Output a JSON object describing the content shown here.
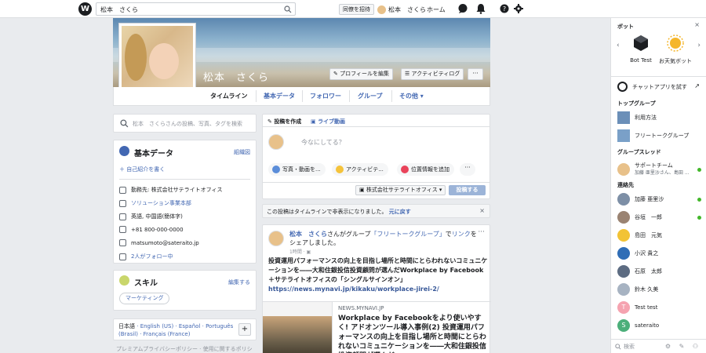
{
  "topbar": {
    "logo": "W",
    "search_value": "松本　さくら",
    "invite_label": "同僚を招待",
    "user_name": "松本　さくら",
    "home_label": "ホーム"
  },
  "profile": {
    "name": "松本　さくら",
    "edit_profile_label": "プロフィールを編集",
    "activity_log_label": "アクティビティログ",
    "more_label": "···",
    "tabs": [
      "タイムライン",
      "基本データ",
      "フォロワー",
      "グループ",
      "その他 ▾"
    ]
  },
  "left": {
    "search_placeholder": "松本　さくらさんの投稿、写真、タグを検索",
    "about": {
      "title": "基本データ",
      "edit_label": "組織図",
      "intro_label": "＋  自己紹介を書く",
      "rows": [
        "勤務先: 株式会社サテライトオフィス",
        "ソリューション事業本部",
        "英語, 中国語(簡体字)",
        "+81 800-000-0000",
        "matsumoto@sateraito.jp",
        "2人がフォロー中"
      ]
    },
    "skills": {
      "title": "スキル",
      "edit_label": "編集する",
      "chip": "マーケティング"
    },
    "languages": {
      "lang1": "日本語",
      "lang2": "English (US)",
      "lang3": "Español",
      "lang4": "Português (Brasil)",
      "lang5": "Français (France)",
      "add_label": "+"
    },
    "footer": "プレミアムプライバシーポリシー · 使用に関するポリシ"
  },
  "composer": {
    "tab_post": "投稿を作成",
    "tab_live": "ライブ動画",
    "placeholder": "今なにしてる？",
    "opt_photo": "写真・動画を...",
    "opt_activity": "アクティビテ...",
    "opt_location": "位置情報を追加",
    "opt_more": "···",
    "target": "株式会社サテライトオフィス ▾",
    "post_label": "投稿する"
  },
  "notice": {
    "text": "この投稿はタイムラインで非表示になりました。",
    "undo": "元に戻す",
    "close": "×"
  },
  "post": {
    "author": "松本　さくら",
    "mid1": "さんがグループ",
    "group": "「フリートークグループ」",
    "mid2": "で",
    "link_word": "リンク",
    "mid3": "をシェアしました。",
    "time": "1時間 · ▣",
    "menu": "···",
    "body": "投資運用パフォーマンスの向上を目指し場所と時間にとらわれないコミュニケーションを――大和住銀投信投資顧問が選んだWorkplace by Facebook＋サテライトオフィスの「シングルサインオン」",
    "url": "https://news.mynavi.jp/kikaku/workplace-jirei-2/",
    "link_domain": "NEWS.MYNAVI.JP",
    "link_title": "Workplace by Facebookをより使いやすく! アドオンツール導入事例(2) 投資運用パフォーマンスの向上を目指し場所と時間にとらわれないコミュニケーションを――大和住銀投信投資顧問が選んだ"
  },
  "right": {
    "title": "ボット",
    "close": "×",
    "bots": [
      "Bot Test",
      "お天気ボット"
    ],
    "try_chat": "チャットアプリを試す",
    "try_arrow": "↗",
    "top_groups_title": "トップグループ",
    "top_groups": [
      "利用方法",
      "フリートークグループ"
    ],
    "group_threads_title": "グループスレッド",
    "thread_name": "サポートチーム",
    "thread_sub": "加藤 亜里沙さん、島田 ...",
    "contacts_title": "連絡先",
    "contacts": [
      "加藤 亜里沙",
      "谷垣　一郎",
      "島田　元気",
      "小沢 貴之",
      "石原　太郎",
      "鈴木 久美",
      "Test test",
      "sateraito"
    ],
    "contact_initials": [
      "",
      "",
      "",
      "",
      "",
      "",
      "T",
      "S"
    ],
    "search_placeholder": "検索",
    "search_icons": "⚙ ✎ ⚇"
  },
  "colors": {
    "brand_blue": "#4267b2",
    "online_green": "#42b72a"
  }
}
